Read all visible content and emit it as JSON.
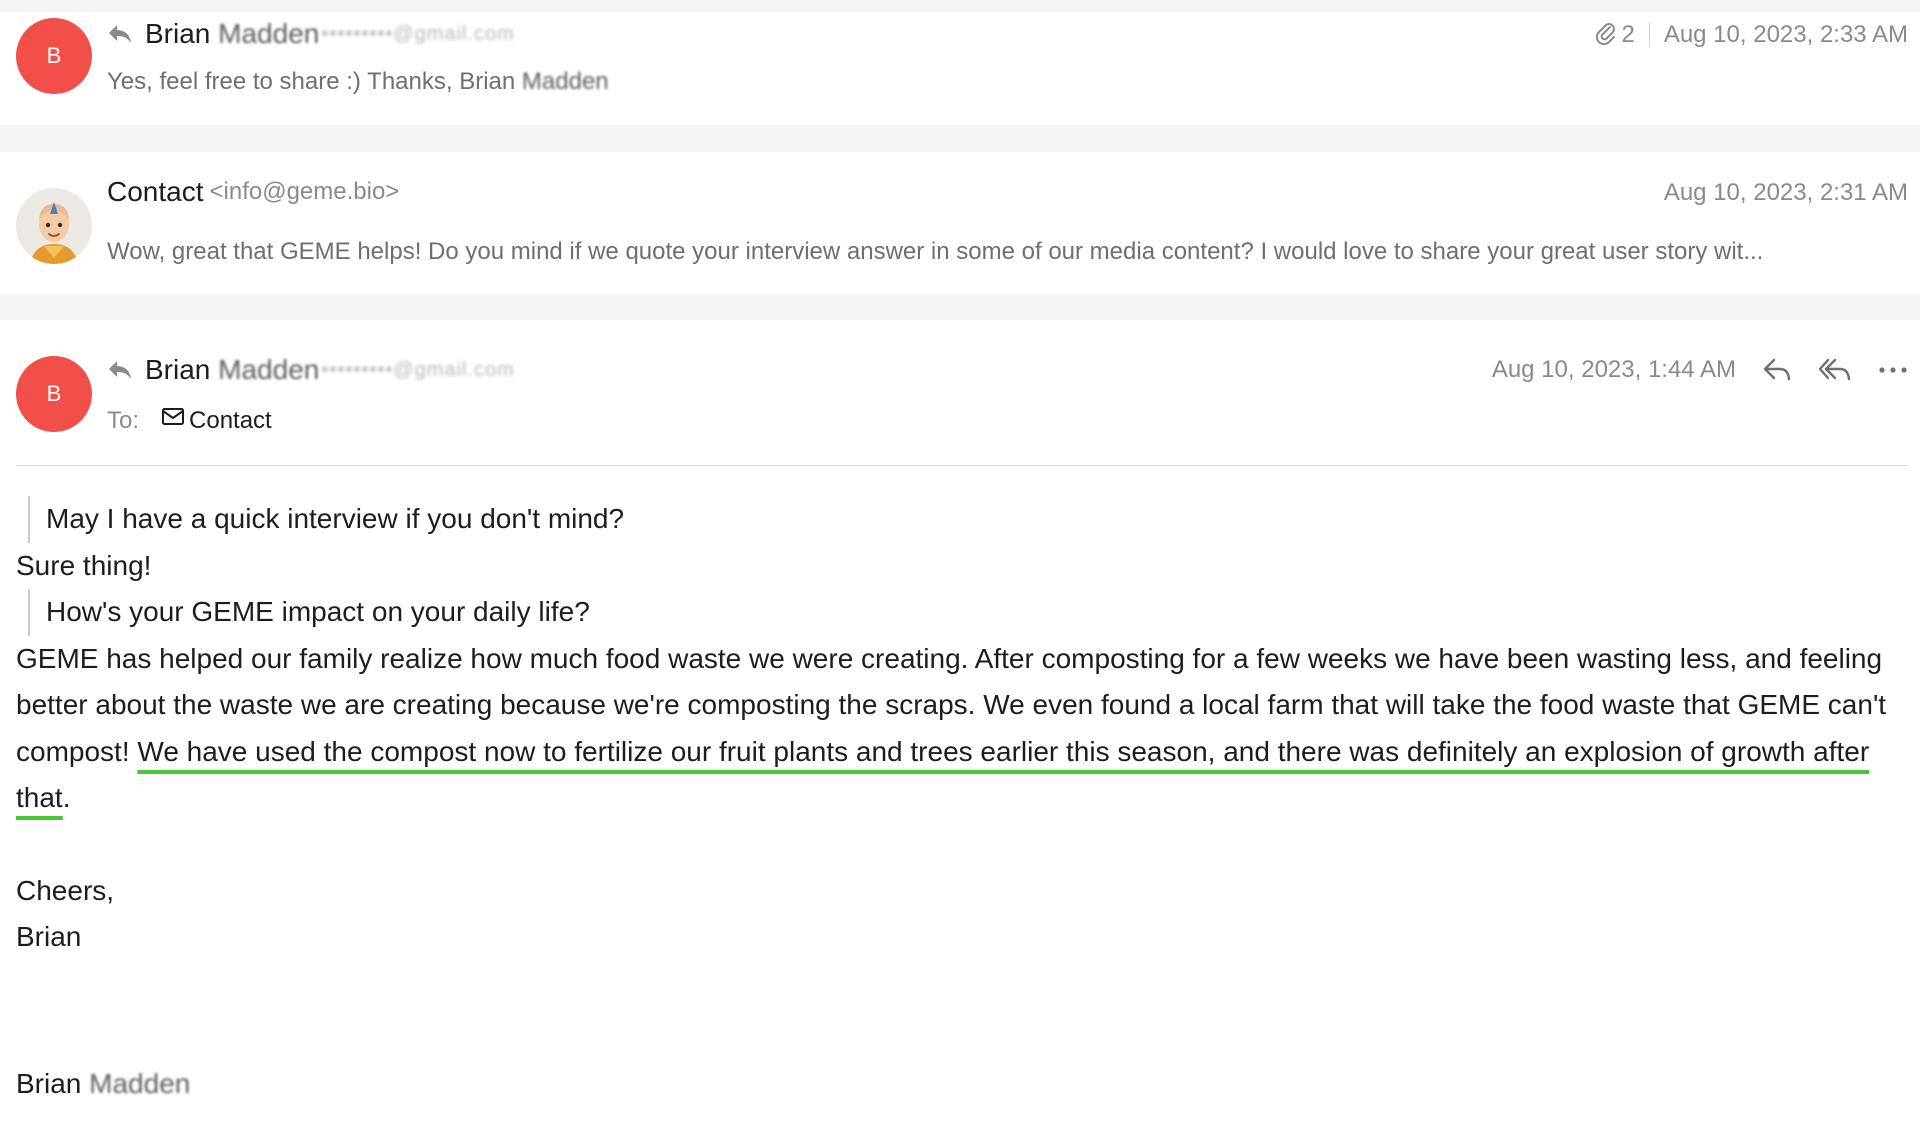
{
  "messages": [
    {
      "avatar_initial": "B",
      "sender_name": "Brian",
      "sender_masked": "Madden",
      "sender_email_redacted": "•••••••••@gmail.com",
      "preview_text": "Yes, feel free to share :) Thanks, Brian",
      "preview_masked": "Madden",
      "attachment_count": "2",
      "date": "Aug 10, 2023, 2:33 AM"
    },
    {
      "sender_name": "Contact",
      "sender_email": "<info@geme.bio>",
      "preview_text": "Wow, great that GEME helps! Do you mind if we quote your interview answer in some of our media content? I would love to share your great user story wit...",
      "date": "Aug 10, 2023, 2:31 AM"
    },
    {
      "avatar_initial": "B",
      "sender_name": "Brian",
      "sender_masked": "Madden",
      "sender_email_redacted": "•••••••••@gmail.com",
      "date": "Aug 10, 2023, 1:44 AM",
      "to_label": "To:",
      "to_contact": "Contact",
      "body": {
        "quote1": "May I have a quick interview if you don't mind?",
        "reply1": "Sure thing!",
        "quote2": "How's your GEME impact on your daily life?",
        "answer_plain": "GEME has helped our family realize how much food waste we were creating. After composting for a few weeks we have been wasting less, and feeling better about the waste we are creating because we're composting the scraps. We even found a local farm that will take the food waste that GEME can't compost! ",
        "answer_highlight": "We have used the compost now to fertilize our fruit plants and trees earlier this season, and there was definitely an explosion of growth after that",
        "answer_end": ".",
        "signoff": "Cheers,",
        "signoff_name": "Brian",
        "signature_first": "Brian",
        "signature_masked": "Madden"
      }
    }
  ],
  "colors": {
    "avatar_red": "#f24f4b",
    "highlight_green": "#45c832",
    "muted_text": "#8a8a8e"
  },
  "icons": [
    "reply-arrow-icon",
    "paperclip-icon",
    "reply-icon",
    "reply-all-icon",
    "more-icon",
    "envelope-icon",
    "contact-avatar-icon"
  ]
}
